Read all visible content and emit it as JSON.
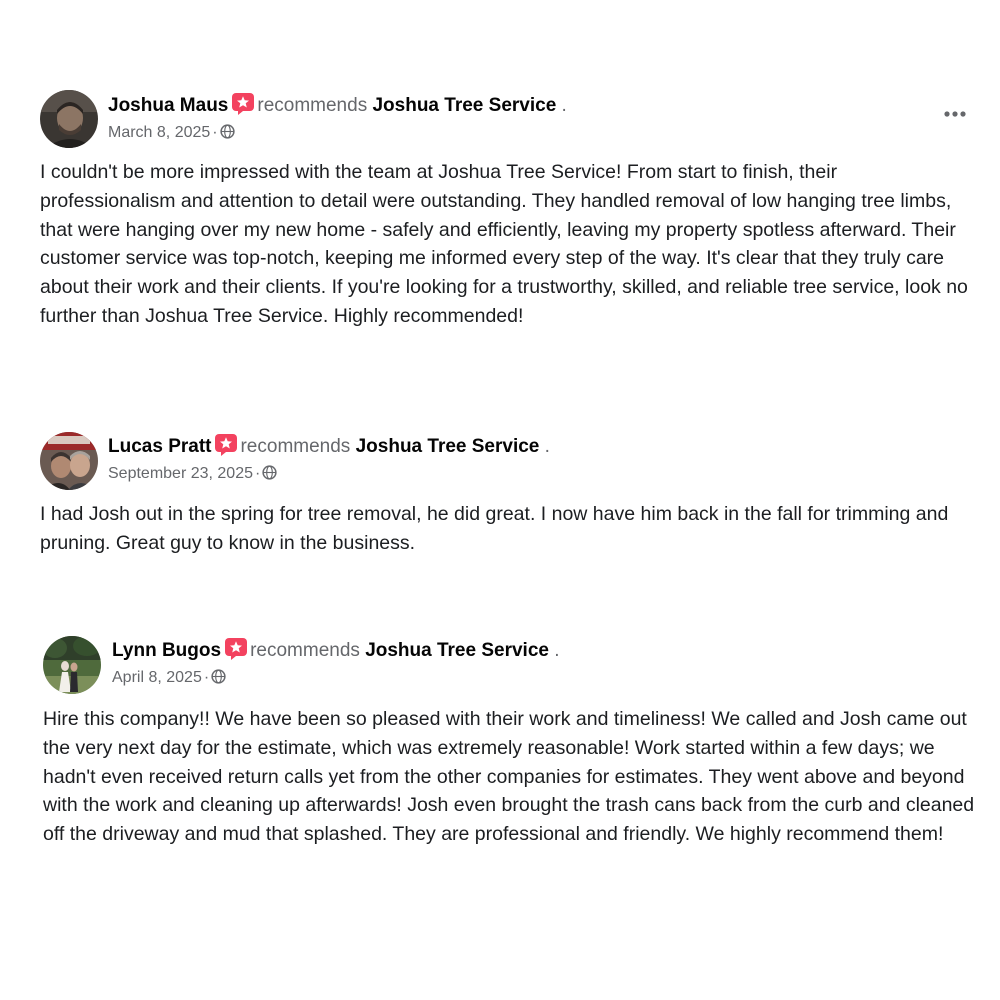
{
  "more_icon": "more-horizontal-icon",
  "reviews": [
    {
      "author": "Joshua Maus",
      "recommends_label": "recommends",
      "page": "Joshua Tree Service",
      "dot": ".",
      "date": "March 8, 2025",
      "separator": "·",
      "privacy_icon": "globe-icon",
      "text": "I couldn't be more impressed with the team at Joshua Tree Service! From start to finish, their professionalism and attention to detail were outstanding. They handled removal of low hanging tree limbs, that were hanging over my new home - safely and efficiently, leaving my property spotless afterward. Their customer service was top-notch, keeping me informed every step of the way. It's clear that they truly care about their work and their clients. If you're looking for a trustworthy, skilled, and reliable tree service, look no further than Joshua Tree Service. Highly recommended!"
    },
    {
      "author": "Lucas Pratt",
      "recommends_label": "recommends",
      "page": "Joshua Tree Service",
      "dot": ".",
      "date": "September 23, 2025",
      "separator": "·",
      "privacy_icon": "globe-icon",
      "text": "I had Josh out in the spring for tree removal, he did great. I now have him back in the fall for trimming and pruning. Great guy to know in the business."
    },
    {
      "author": "Lynn Bugos",
      "recommends_label": "recommends",
      "page": "Joshua Tree Service",
      "dot": ".",
      "date": "April 8, 2025",
      "separator": "·",
      "privacy_icon": "globe-icon",
      "text": "Hire this company!! We have been so pleased with their work and timeliness! We called and Josh came out the very next day for the estimate, which was extremely reasonable! Work started within a few days; we hadn't even received return calls yet from the other companies for estimates. They went above and beyond with the work and cleaning up afterwards! Josh even brought the trash cans back from the curb and cleaned off the driveway and mud that splashed. They are professional and friendly. We highly recommend them!"
    }
  ],
  "colors": {
    "recommend_badge": "#f3425f",
    "secondary_text": "#65676b",
    "primary_text": "#050505"
  }
}
